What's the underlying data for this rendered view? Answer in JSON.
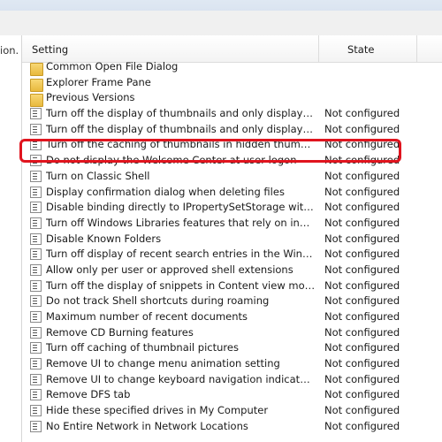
{
  "left_column": {
    "cut_text": "ion."
  },
  "header": {
    "setting": "Setting",
    "state": "State"
  },
  "folders": [
    "Common Open File Dialog",
    "Explorer Frame Pane",
    "Previous Versions"
  ],
  "policies": [
    {
      "name": "Turn off the display of thumbnails and only display icons.",
      "state": "Not configured"
    },
    {
      "name": "Turn off the display of thumbnails and only display icons on...",
      "state": "Not configured"
    },
    {
      "name": "Turn off the caching of thumbnails in hidden thumbs.db files",
      "state": "Not configured"
    },
    {
      "name": "Do not display the Welcome Center at user logon",
      "state": "Not configured"
    },
    {
      "name": "Turn on Classic Shell",
      "state": "Not configured"
    },
    {
      "name": "Display confirmation dialog when deleting files",
      "state": "Not configured"
    },
    {
      "name": "Disable binding directly to IPropertySetStorage without inter...",
      "state": "Not configured"
    },
    {
      "name": "Turn off Windows Libraries features that rely on indexed file ...",
      "state": "Not configured"
    },
    {
      "name": "Disable Known Folders",
      "state": "Not configured"
    },
    {
      "name": "Turn off display of recent search entries in the Windows Expl...",
      "state": "Not configured"
    },
    {
      "name": "Allow only per user or approved shell extensions",
      "state": "Not configured"
    },
    {
      "name": "Turn off the display of snippets in Content view mode",
      "state": "Not configured"
    },
    {
      "name": "Do not track Shell shortcuts during roaming",
      "state": "Not configured"
    },
    {
      "name": "Maximum number of recent documents",
      "state": "Not configured"
    },
    {
      "name": "Remove CD Burning features",
      "state": "Not configured"
    },
    {
      "name": "Turn off caching of thumbnail pictures",
      "state": "Not configured"
    },
    {
      "name": "Remove UI to change menu animation setting",
      "state": "Not configured"
    },
    {
      "name": "Remove UI to change keyboard navigation indicator setting",
      "state": "Not configured"
    },
    {
      "name": "Remove DFS tab",
      "state": "Not configured"
    },
    {
      "name": "Hide these specified drives in My Computer",
      "state": "Not configured"
    },
    {
      "name": "No Entire Network in Network Locations",
      "state": "Not configured"
    }
  ],
  "highlight_color": "#e0141e"
}
